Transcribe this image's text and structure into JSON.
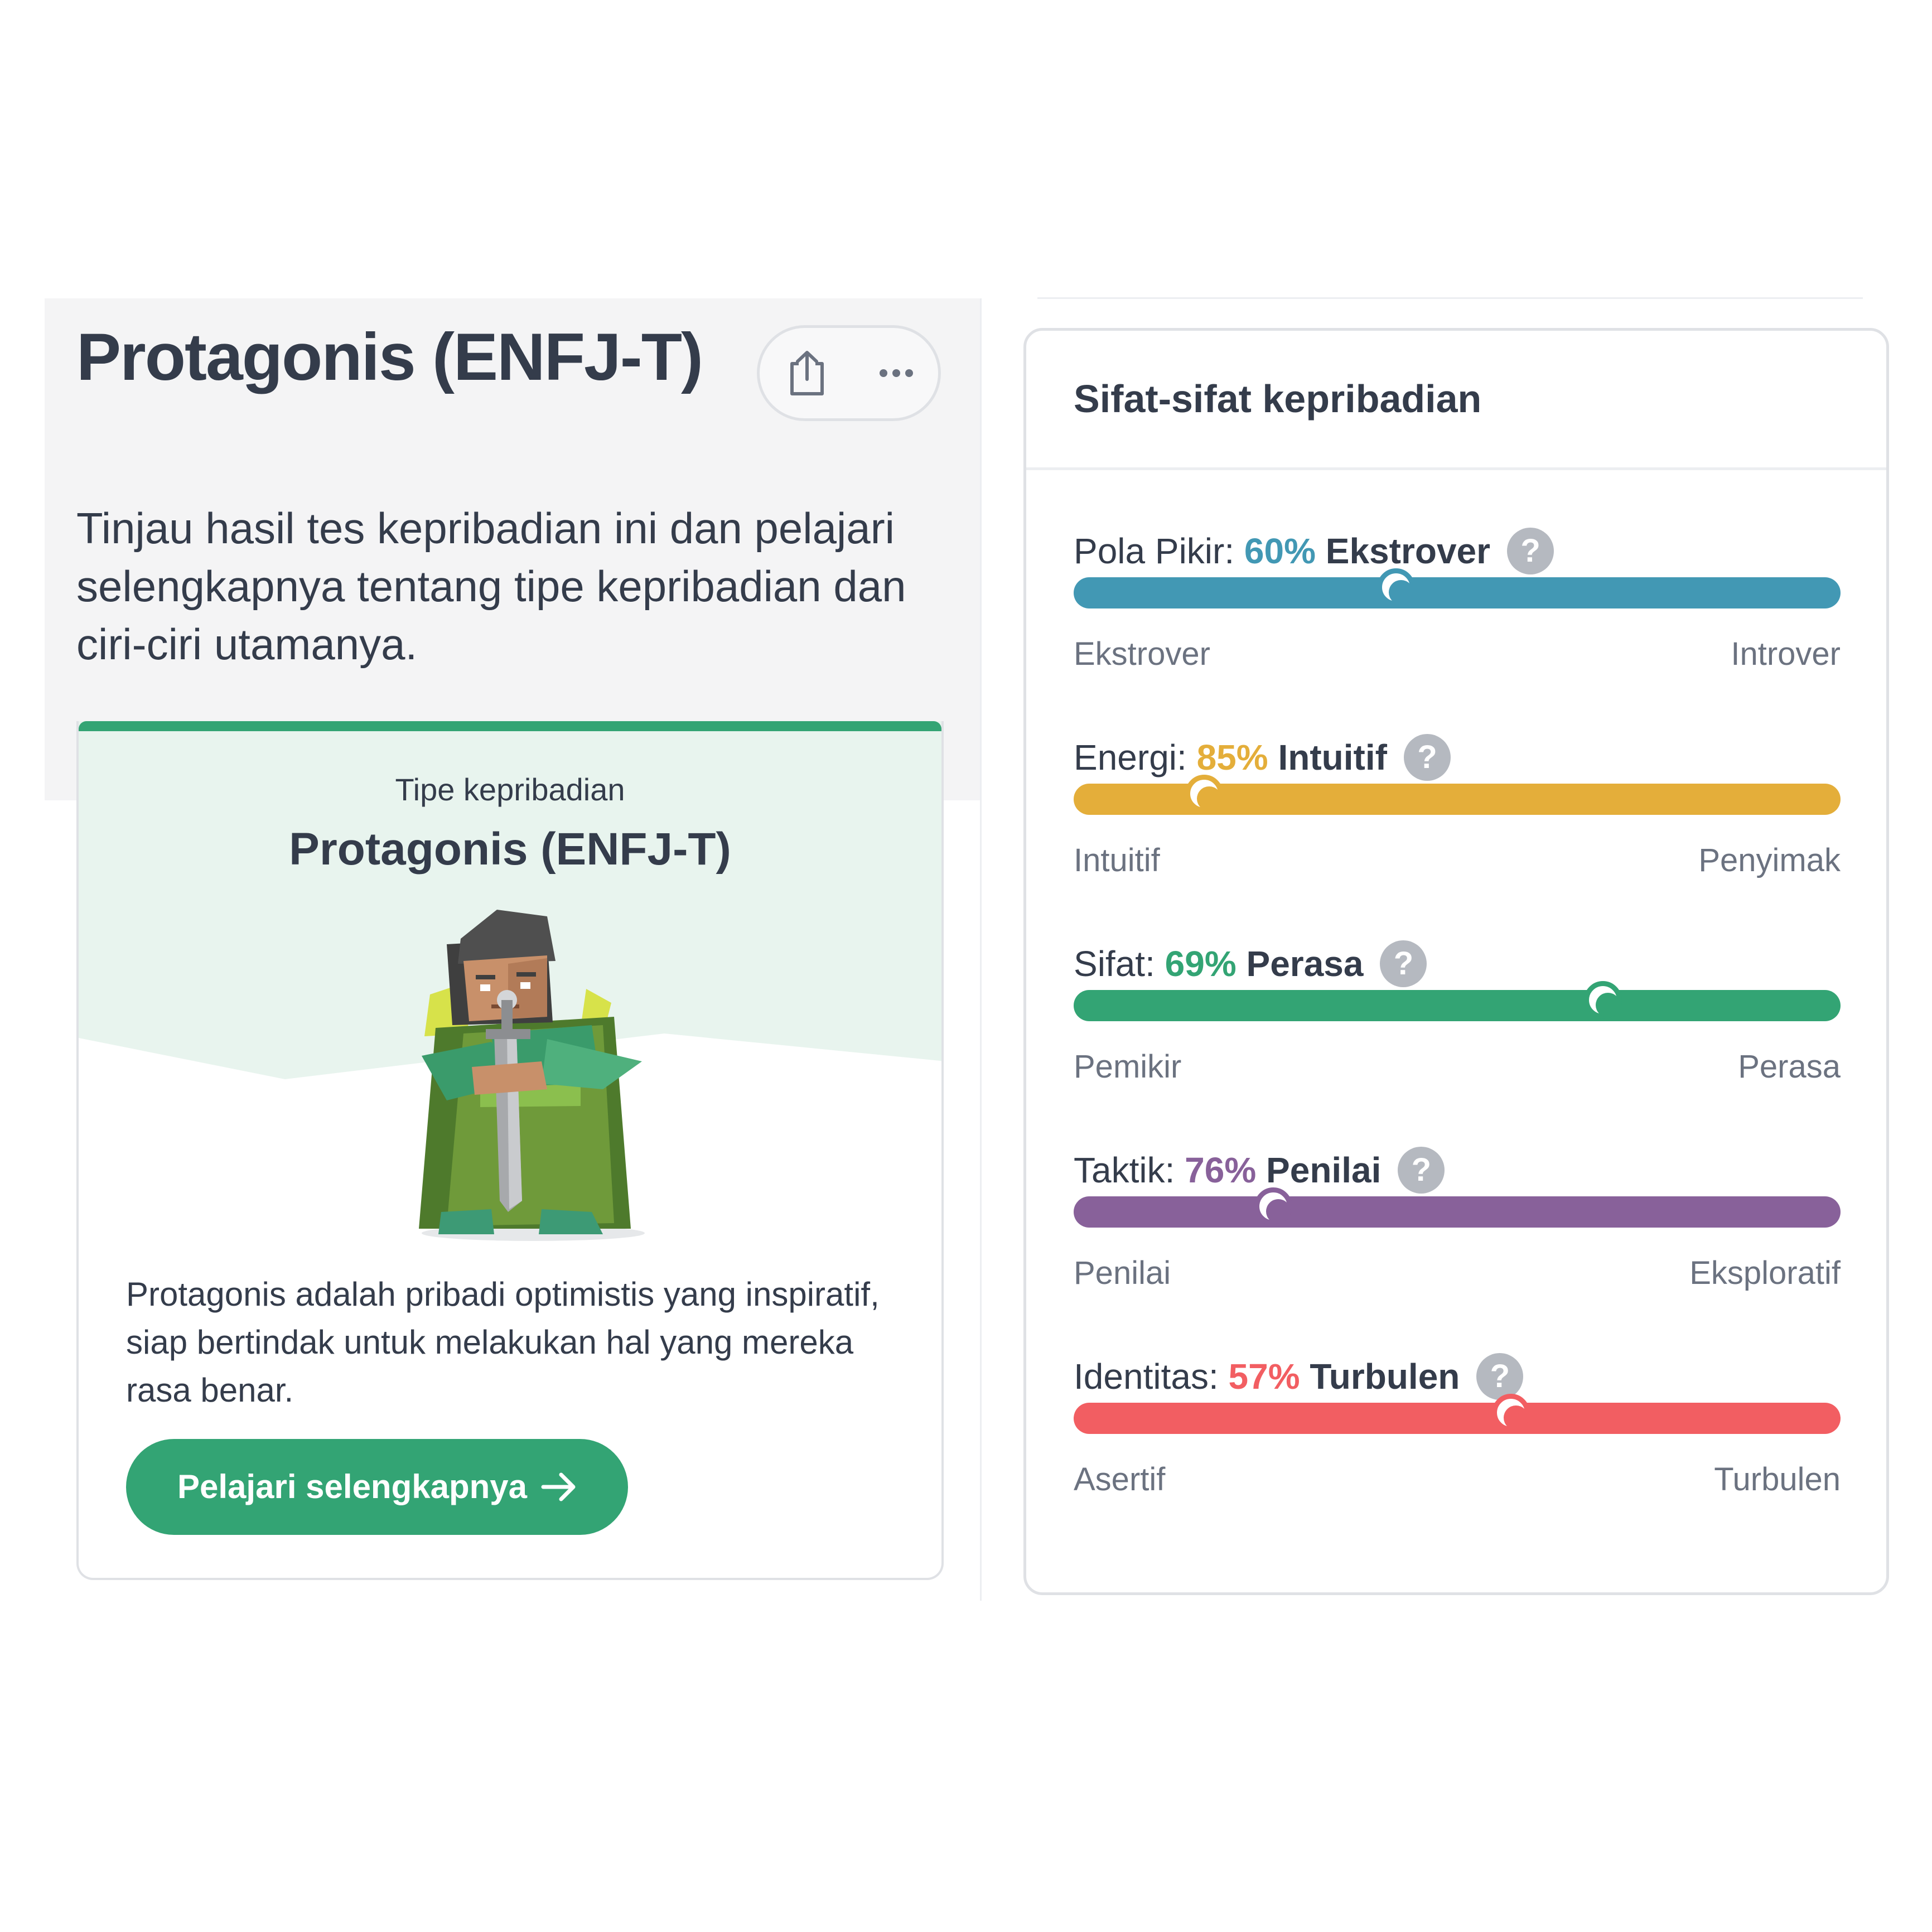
{
  "header": {
    "title": "Protagonis (ENFJ-T)",
    "intro": "Tinjau hasil tes kepribadian ini dan pelajari selengkapnya tentang tipe kepribadian dan ciri-ciri utamanya.",
    "share_icon": "share-icon",
    "more_icon": "more-options-icon"
  },
  "type_card": {
    "label": "Tipe kepribadian",
    "type": "Protagonis (ENFJ-T)",
    "description": "Protagonis adalah pribadi optimistis yang inspiratif, siap bertindak untuk melakukan hal yang mereka rasa benar.",
    "cta_label": "Pelajari selengkapnya",
    "accent_color": "#33a474",
    "avatar": "protagonist-character-illustration"
  },
  "traits": {
    "title": "Sifat-sifat kepribadian",
    "items": [
      {
        "name": "Pola Pikir:",
        "pct": "60%",
        "dominant": "Ekstrover",
        "left": "Ekstrover",
        "right": "Introver",
        "color": "#4298b4",
        "position": 0.42
      },
      {
        "name": "Energi:",
        "pct": "85%",
        "dominant": "Intuitif",
        "left": "Intuitif",
        "right": "Penyimak",
        "color": "#e4ae3a",
        "position": 0.17
      },
      {
        "name": "Sifat:",
        "pct": "69%",
        "dominant": "Perasa",
        "left": "Pemikir",
        "right": "Perasa",
        "color": "#33a474",
        "position": 0.69
      },
      {
        "name": "Taktik:",
        "pct": "76%",
        "dominant": "Penilai",
        "left": "Penilai",
        "right": "Eksploratif",
        "color": "#88619a",
        "position": 0.26
      },
      {
        "name": "Identitas:",
        "pct": "57%",
        "dominant": "Turbulen",
        "left": "Asertif",
        "right": "Turbulen",
        "color": "#f25e62",
        "position": 0.57
      }
    ]
  }
}
